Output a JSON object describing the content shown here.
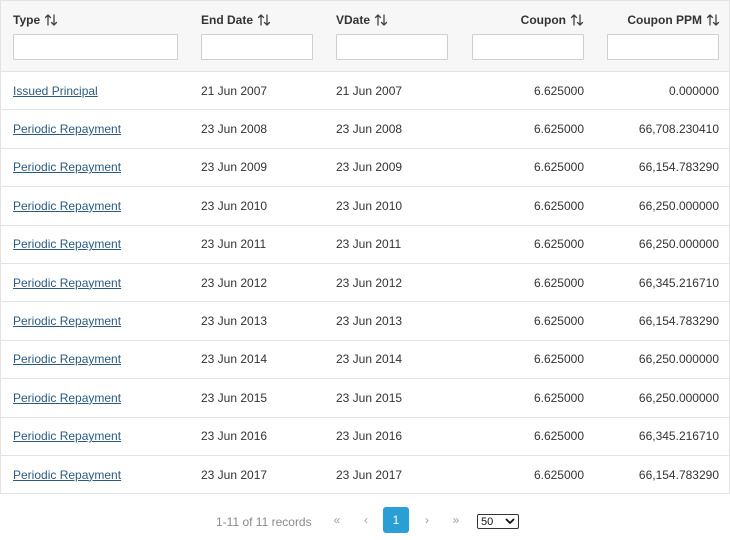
{
  "table": {
    "columns": [
      {
        "label": "Type",
        "align": "left"
      },
      {
        "label": "End Date",
        "align": "left"
      },
      {
        "label": "VDate",
        "align": "left"
      },
      {
        "label": "Coupon",
        "align": "right"
      },
      {
        "label": "Coupon PPM",
        "align": "right"
      }
    ],
    "rows": [
      {
        "type": "Issued Principal",
        "end_date": "21 Jun 2007",
        "vdate": "21 Jun 2007",
        "coupon": "6.625000",
        "coupon_ppm": "0.000000"
      },
      {
        "type": "Periodic Repayment",
        "end_date": "23 Jun 2008",
        "vdate": "23 Jun 2008",
        "coupon": "6.625000",
        "coupon_ppm": "66,708.230410"
      },
      {
        "type": "Periodic Repayment",
        "end_date": "23 Jun 2009",
        "vdate": "23 Jun 2009",
        "coupon": "6.625000",
        "coupon_ppm": "66,154.783290"
      },
      {
        "type": "Periodic Repayment",
        "end_date": "23 Jun 2010",
        "vdate": "23 Jun 2010",
        "coupon": "6.625000",
        "coupon_ppm": "66,250.000000"
      },
      {
        "type": "Periodic Repayment",
        "end_date": "23 Jun 2011",
        "vdate": "23 Jun 2011",
        "coupon": "6.625000",
        "coupon_ppm": "66,250.000000"
      },
      {
        "type": "Periodic Repayment",
        "end_date": "23 Jun 2012",
        "vdate": "23 Jun 2012",
        "coupon": "6.625000",
        "coupon_ppm": "66,345.216710"
      },
      {
        "type": "Periodic Repayment",
        "end_date": "23 Jun 2013",
        "vdate": "23 Jun 2013",
        "coupon": "6.625000",
        "coupon_ppm": "66,154.783290"
      },
      {
        "type": "Periodic Repayment",
        "end_date": "23 Jun 2014",
        "vdate": "23 Jun 2014",
        "coupon": "6.625000",
        "coupon_ppm": "66,250.000000"
      },
      {
        "type": "Periodic Repayment",
        "end_date": "23 Jun 2015",
        "vdate": "23 Jun 2015",
        "coupon": "6.625000",
        "coupon_ppm": "66,250.000000"
      },
      {
        "type": "Periodic Repayment",
        "end_date": "23 Jun 2016",
        "vdate": "23 Jun 2016",
        "coupon": "6.625000",
        "coupon_ppm": "66,345.216710"
      },
      {
        "type": "Periodic Repayment",
        "end_date": "23 Jun 2017",
        "vdate": "23 Jun 2017",
        "coupon": "6.625000",
        "coupon_ppm": "66,154.783290"
      }
    ]
  },
  "pagination": {
    "summary": "1-11 of 11 records",
    "first_icon": "«",
    "prev_icon": "‹",
    "current_page": "1",
    "next_icon": "›",
    "last_icon": "»",
    "page_size": "50",
    "page_size_options": [
      "50"
    ]
  },
  "icons": {
    "sort": "sort-arrows-icon",
    "first": "double-chevron-left-icon",
    "prev": "chevron-left-icon",
    "next": "chevron-right-icon",
    "last": "double-chevron-right-icon",
    "dropdown": "chevron-down-icon"
  },
  "colors": {
    "link": "#2b5a80",
    "page_active_bg": "#2a9fd6",
    "header_bg": "#f7f7f7",
    "border": "#e3e3e3"
  }
}
